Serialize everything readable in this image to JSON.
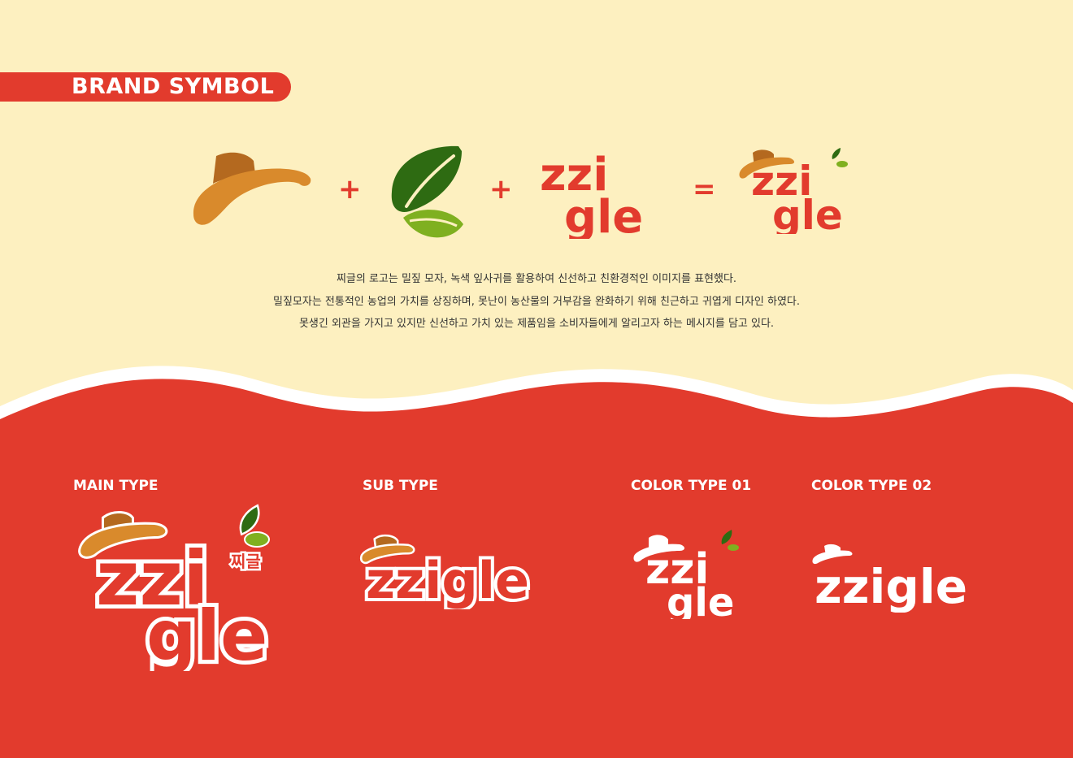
{
  "header": {
    "title": "BRAND SYMBOL"
  },
  "equation": {
    "op1": "+",
    "op2": "+",
    "op3": "=",
    "logo_text_line1": "zzi",
    "logo_text_line2": "gle"
  },
  "description": {
    "lines": [
      "찌글의 로고는 밀짚 모자, 녹색 잎사귀를 활용하여 신선하고 친환경적인 이미지를 표현했다.",
      "밀짚모자는 전통적인 농업의 가치를 상징하며, 못난이 농산물의 거부감을 완화하기 위해 친근하고 귀엽게 디자인 하였다.",
      "못생긴 외관을 가지고 있지만 신선하고 가치 있는 제품임을 소비자들에게 알리고자 하는 메시지를 담고 있다."
    ]
  },
  "types": [
    {
      "label": "MAIN TYPE",
      "korean": "찌글",
      "logo_line1": "zzi",
      "logo_line2": "gle"
    },
    {
      "label": "SUB TYPE",
      "logo": "zzigle"
    },
    {
      "label": "COLOR TYPE 01",
      "logo_line1": "zzi",
      "logo_line2": "gle"
    },
    {
      "label": "COLOR TYPE 02",
      "logo": "zzigle"
    }
  ],
  "colors": {
    "cream": "#fdf0c0",
    "brand_red": "#e23b2d",
    "hat_orange": "#d98a2c",
    "hat_brown": "#b4691f",
    "leaf_dark": "#2e6b12",
    "leaf_light": "#7fb020",
    "white": "#ffffff"
  }
}
